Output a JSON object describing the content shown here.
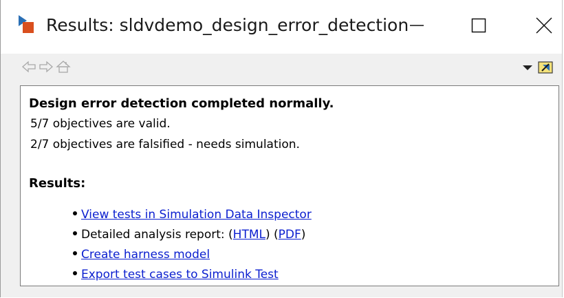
{
  "window": {
    "title": "Results: sldvdemo_design_error_detection"
  },
  "toolbar": {
    "back_icon": "back-arrow-icon",
    "forward_icon": "forward-arrow-icon",
    "home_icon": "home-icon",
    "dropdown_icon": "dropdown-triangle-icon",
    "dock_icon": "dock-icon"
  },
  "content": {
    "headline": "Design error detection completed normally.",
    "lines": [
      "5/7 objectives are valid.",
      "2/7 objectives are falsified - needs simulation."
    ],
    "results_heading": "Results:",
    "items": [
      {
        "link": "View tests in Simulation Data Inspector"
      },
      {
        "text": "Detailed analysis report: (",
        "link_html": "HTML",
        "mid": ") (",
        "link_pdf": "PDF",
        "end": ")"
      },
      {
        "link": "Create harness model"
      },
      {
        "link": "Export test cases to Simulink Test"
      }
    ]
  },
  "colors": {
    "link": "#0a1ecf",
    "background": "#f0f0f0",
    "titlebar": "#ffffff"
  }
}
